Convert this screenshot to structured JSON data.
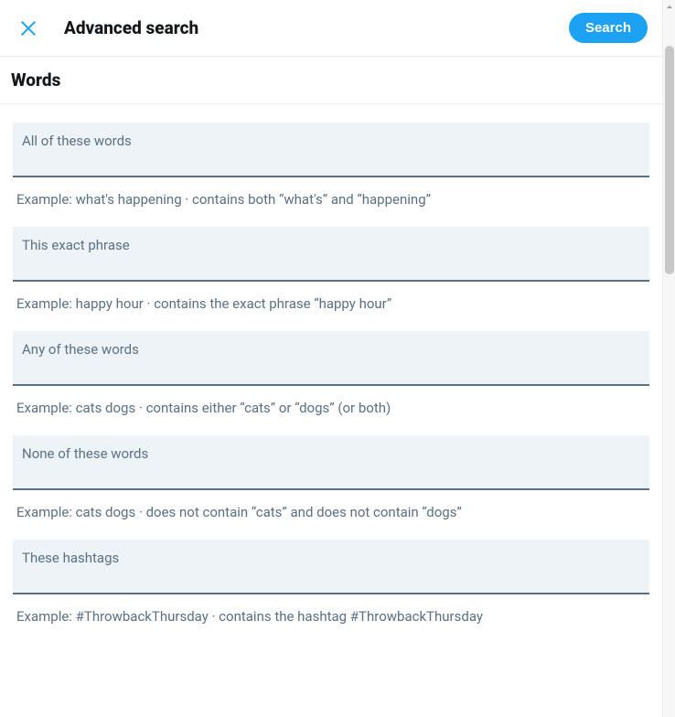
{
  "header": {
    "title": "Advanced search",
    "search_button": "Search"
  },
  "section": {
    "title": "Words"
  },
  "fields": [
    {
      "label": "All of these words",
      "example": "Example: what's happening · contains both “what's” and “happening”"
    },
    {
      "label": "This exact phrase",
      "example": "Example: happy hour · contains the exact phrase “happy hour”"
    },
    {
      "label": "Any of these words",
      "example": "Example: cats dogs · contains either “cats” or “dogs” (or both)"
    },
    {
      "label": "None of these words",
      "example": "Example: cats dogs · does not contain “cats” and does not contain “dogs”"
    },
    {
      "label": "These hashtags",
      "example": "Example: #ThrowbackThursday · contains the hashtag #ThrowbackThursday"
    }
  ]
}
